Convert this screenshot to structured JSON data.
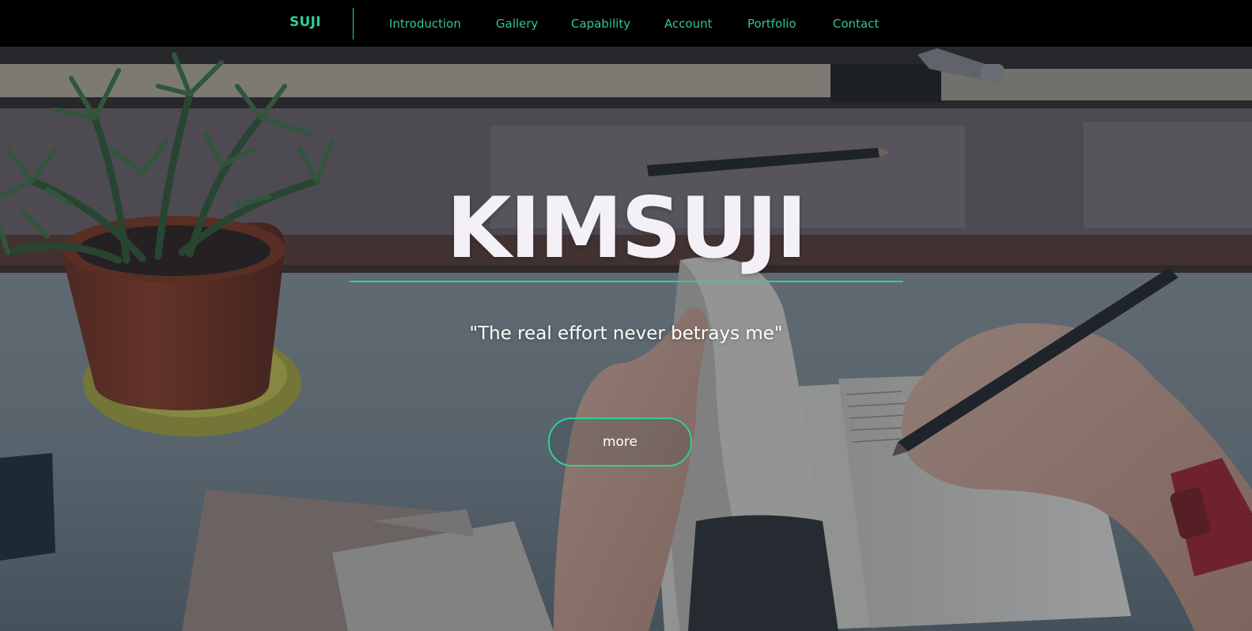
{
  "nav": {
    "brand": "SUJI",
    "items": [
      {
        "label": "Introduction"
      },
      {
        "label": "Gallery"
      },
      {
        "label": "Capability"
      },
      {
        "label": "Account"
      },
      {
        "label": "Portfolio"
      },
      {
        "label": "Contact"
      }
    ]
  },
  "hero": {
    "title": "KIMSUJI",
    "quote": "\"The real effort never betrays me\"",
    "more_label": "more"
  },
  "colors": {
    "accent": "#2fd094",
    "nav_background": "#000000",
    "title_text": "#f3f1f6"
  }
}
